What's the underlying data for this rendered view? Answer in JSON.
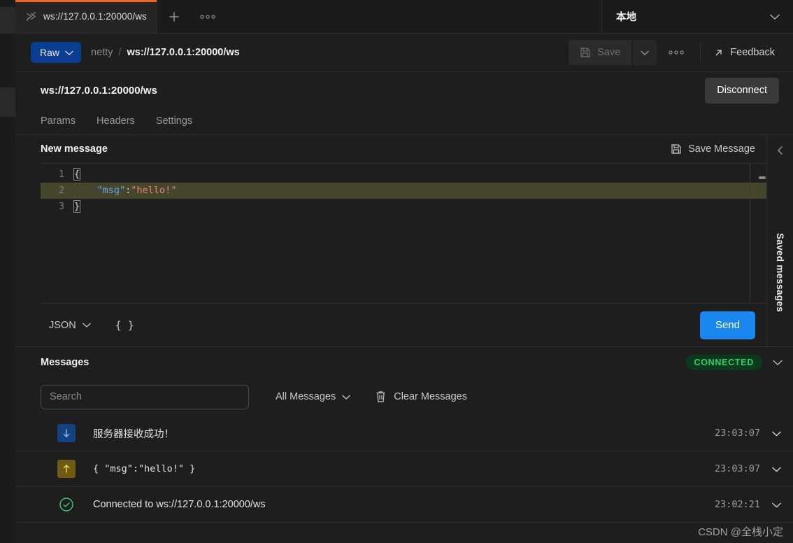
{
  "tabstrip": {
    "tab_label": "ws://127.0.0.1:20000/ws",
    "tab_icon": "websocket-icon",
    "new_tab_label": "+",
    "more_label": "●●●",
    "environment": "本地"
  },
  "actionbar": {
    "mode_label": "Raw",
    "breadcrumb_workspace": "netty",
    "breadcrumb_separator": "/",
    "breadcrumb_current": "ws://127.0.0.1:20000/ws",
    "save_label": "Save",
    "more_label": "●●●",
    "feedback_label": "Feedback"
  },
  "request": {
    "url": "ws://127.0.0.1:20000/ws",
    "disconnect_label": "Disconnect",
    "tabs": [
      {
        "label": "Params"
      },
      {
        "label": "Headers"
      },
      {
        "label": "Settings"
      }
    ]
  },
  "editor": {
    "title": "New message",
    "save_message_label": "Save Message",
    "lines": [
      {
        "n": "1",
        "text": "{",
        "kind": "brace"
      },
      {
        "n": "2",
        "text": "    \"msg\":\"hello!\"",
        "kind": "pair",
        "key": "\"msg\"",
        "punct": ":",
        "value": "\"hello!\"",
        "indent": "    ",
        "highlighted": true
      },
      {
        "n": "3",
        "text": "}",
        "kind": "brace"
      }
    ],
    "format_label": "JSON",
    "beautify_label": "{ }",
    "send_label": "Send"
  },
  "saved_rail": {
    "label": "Saved messages",
    "collapse_icon": "chevron-left-icon"
  },
  "messages": {
    "title": "Messages",
    "status_badge": "CONNECTED",
    "search_placeholder": "Search",
    "search_value": "",
    "filter_label": "All Messages",
    "clear_label": "Clear Messages",
    "rows": [
      {
        "direction": "in",
        "icon": "arrow-down-icon",
        "text": "服务器接收成功！",
        "time": "23:03:07",
        "mono": false
      },
      {
        "direction": "out",
        "icon": "arrow-up-icon",
        "text": "{ \"msg\":\"hello!\" }",
        "time": "23:03:07",
        "mono": true
      },
      {
        "direction": "ok",
        "icon": "check-circle-icon",
        "text": "Connected to ws://127.0.0.1:20000/ws",
        "time": "23:02:21",
        "mono": false
      }
    ]
  },
  "watermark": {
    "text": "CSDN @全栈小定"
  },
  "colors": {
    "accent_tab": "#f26522",
    "send_button": "#1a86f0",
    "raw_button": "#0b3d91",
    "connected_bg": "#0c3a1d",
    "connected_text": "#2fd06c",
    "highlight_line": "#46462f",
    "json_key": "#6aa8e0",
    "json_string": "#e0886b"
  }
}
